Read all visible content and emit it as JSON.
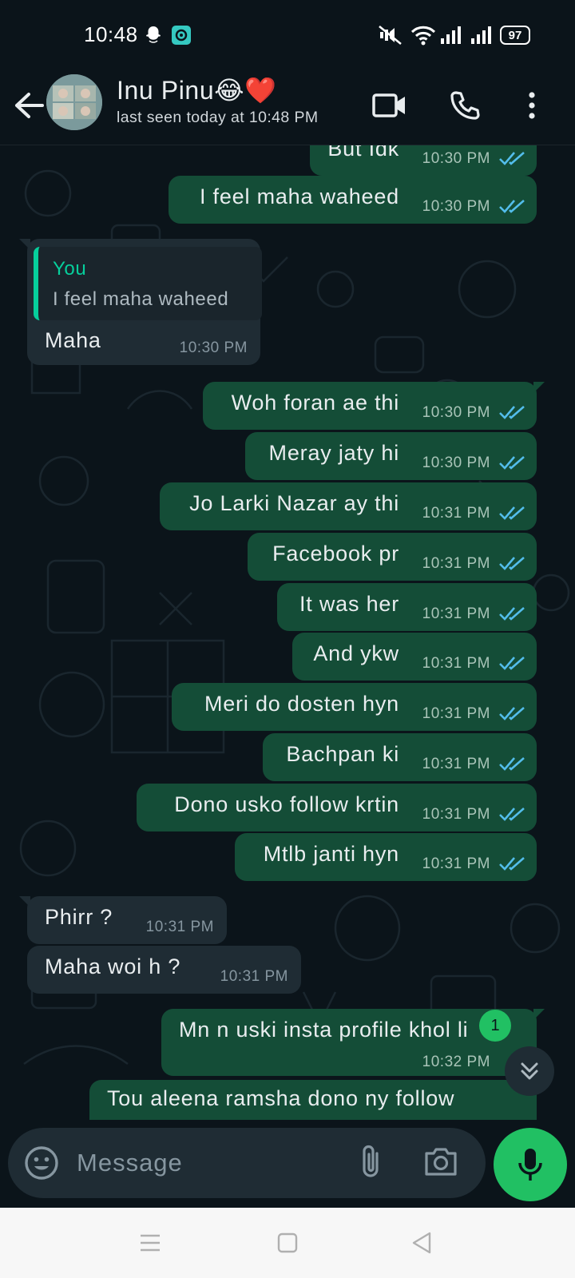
{
  "status_bar": {
    "time": "10:48",
    "battery": "97",
    "icons": [
      "snapchat-icon",
      "app-icon",
      "mute-icon",
      "wifi-icon",
      "signal-icon",
      "signal-icon",
      "battery-icon"
    ]
  },
  "header": {
    "contact_name": "Inu Pinu😂❤️",
    "last_seen": "last seen today at 10:48 PM",
    "icons": [
      "back-arrow-icon",
      "video-call-icon",
      "phone-call-icon",
      "more-options-icon"
    ]
  },
  "messages": [
    {
      "direction": "out",
      "text": "But Idk",
      "time": "10:30 PM"
    },
    {
      "direction": "out",
      "text": "I feel maha waheed",
      "time": "10:30 PM"
    },
    {
      "direction": "in",
      "quote_author": "You",
      "quote_text": "I feel maha waheed",
      "text": "Maha",
      "time": "10:30 PM"
    },
    {
      "direction": "out",
      "text": "Woh foran ae thi",
      "time": "10:30 PM"
    },
    {
      "direction": "out",
      "text": "Meray jaty hi",
      "time": "10:30 PM"
    },
    {
      "direction": "out",
      "text": "Jo Larki Nazar ay thi",
      "time": "10:31 PM"
    },
    {
      "direction": "out",
      "text": "Facebook pr",
      "time": "10:31 PM"
    },
    {
      "direction": "out",
      "text": "It was her",
      "time": "10:31 PM"
    },
    {
      "direction": "out",
      "text": "And ykw",
      "time": "10:31 PM"
    },
    {
      "direction": "out",
      "text": "Meri do dosten hyn",
      "time": "10:31 PM"
    },
    {
      "direction": "out",
      "text": "Bachpan ki",
      "time": "10:31 PM"
    },
    {
      "direction": "out",
      "text": "Dono usko follow krtin",
      "time": "10:31 PM"
    },
    {
      "direction": "out",
      "text": "Mtlb janti hyn",
      "time": "10:31 PM"
    },
    {
      "direction": "in",
      "text": "Phirr ?",
      "time": "10:31 PM"
    },
    {
      "direction": "in",
      "text": "Maha woi h ?",
      "time": "10:31 PM"
    },
    {
      "direction": "out",
      "text": "Mn n uski insta profile khol li",
      "time": "10:32 PM"
    },
    {
      "direction": "out",
      "text": "Tou aleena ramsha dono ny follow",
      "time": ""
    }
  ],
  "unread_count": "1",
  "compose": {
    "placeholder": "Message",
    "icons": [
      "emoji-icon",
      "attach-icon",
      "camera-icon",
      "mic-icon"
    ]
  },
  "navbar": {
    "icons": [
      "menu-icon",
      "home-icon",
      "back-icon"
    ]
  },
  "colors": {
    "background": "#0b141a",
    "outgoing_bubble": "#144d37",
    "incoming_bubble": "#1f2c34",
    "accent_green": "#21c063",
    "read_tick_blue": "#53bdeb",
    "quote_green": "#06cf9c"
  }
}
